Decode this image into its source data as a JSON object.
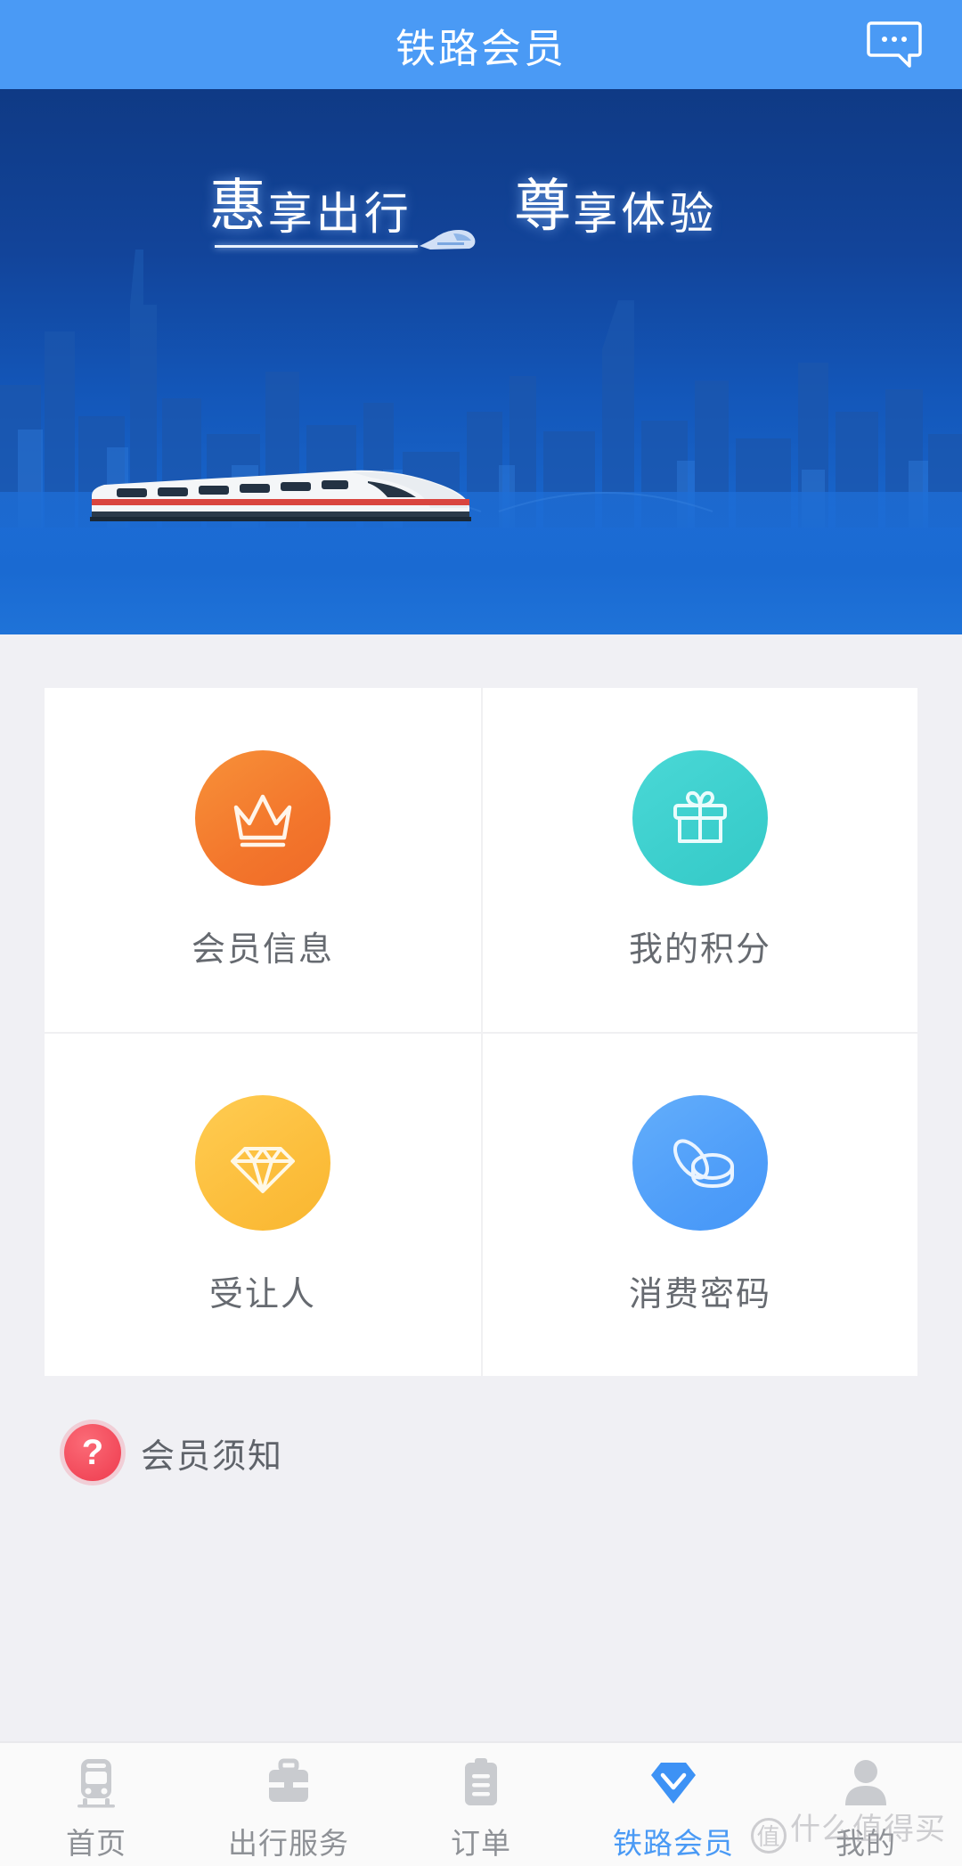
{
  "header": {
    "title": "铁路会员",
    "message_icon": "message-bubble-icon"
  },
  "banner": {
    "line1_big": "惠",
    "line1_small": "享出行",
    "line2_big": "尊",
    "line2_small": "享体验",
    "train_icon": "high-speed-train-icon"
  },
  "card": {
    "items": [
      {
        "label": "会员信息",
        "icon": "crown-icon",
        "color": "#f3762c"
      },
      {
        "label": "我的积分",
        "icon": "gift-icon",
        "color": "#3ccfcd"
      },
      {
        "label": "受让人",
        "icon": "diamond-icon",
        "color": "#fcbe3c"
      },
      {
        "label": "消费密码",
        "icon": "coins-icon",
        "color": "#4f9ef9"
      }
    ]
  },
  "notice": {
    "icon": "question-mark-icon",
    "glyph": "?",
    "label": "会员须知"
  },
  "tabbar": {
    "items": [
      {
        "label": "首页",
        "icon": "train-icon",
        "active": false
      },
      {
        "label": "出行服务",
        "icon": "briefcase-icon",
        "active": false
      },
      {
        "label": "订单",
        "icon": "clipboard-icon",
        "active": false
      },
      {
        "label": "铁路会员",
        "icon": "diamond-badge-icon",
        "active": true
      },
      {
        "label": "我的",
        "icon": "person-icon",
        "active": false
      }
    ],
    "active_color": "#4a9af5",
    "inactive_color": "#8e9196"
  },
  "watermark": {
    "badge": "值",
    "text": "什么值得买"
  }
}
